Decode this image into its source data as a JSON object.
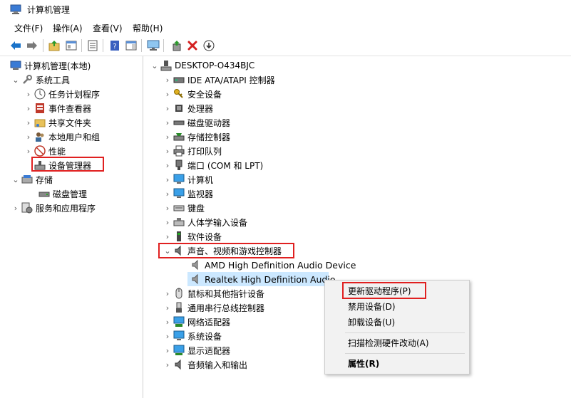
{
  "window": {
    "title": "计算机管理"
  },
  "menu": [
    "文件(F)",
    "操作(A)",
    "查看(V)",
    "帮助(H)"
  ],
  "toolbar": {
    "icons": [
      "back-arrow-icon",
      "forward-arrow-icon",
      "up-folder-icon",
      "console-tree-icon",
      "properties-icon",
      "help-icon",
      "action-pane-icon",
      "monitor-icon",
      "update-driver-icon",
      "uninstall-x-icon",
      "disable-device-icon"
    ],
    "colors": {
      "back": "#1a73c9",
      "delete": "#d42020"
    }
  },
  "left_tree": {
    "root": "计算机管理(本地)",
    "system_tools": "系统工具",
    "task_scheduler": "任务计划程序",
    "event_viewer": "事件查看器",
    "shared_folders": "共享文件夹",
    "local_users": "本地用户和组",
    "performance": "性能",
    "device_manager": "设备管理器",
    "storage": "存储",
    "disk_management": "磁盘管理",
    "services_apps": "服务和应用程序"
  },
  "device_tree": {
    "computer_name": "DESKTOP-O434BJC",
    "categories": [
      "IDE ATA/ATAPI 控制器",
      "安全设备",
      "处理器",
      "磁盘驱动器",
      "存储控制器",
      "打印队列",
      "端口 (COM 和 LPT)",
      "计算机",
      "监视器",
      "键盘",
      "人体学输入设备",
      "软件设备",
      "声音、视频和游戏控制器",
      "鼠标和其他指针设备",
      "通用串行总线控制器",
      "网络适配器",
      "系统设备",
      "显示适配器",
      "音频输入和输出"
    ],
    "audio_children": [
      "AMD High Definition Audio Device",
      "Realtek High Definition Audio"
    ]
  },
  "context_menu": {
    "update_driver": "更新驱动程序(P)",
    "disable_device": "禁用设备(D)",
    "uninstall_device": "卸载设备(U)",
    "scan_hardware": "扫描检测硬件改动(A)",
    "properties": "属性(R)"
  },
  "highlight_color": "#e02020"
}
